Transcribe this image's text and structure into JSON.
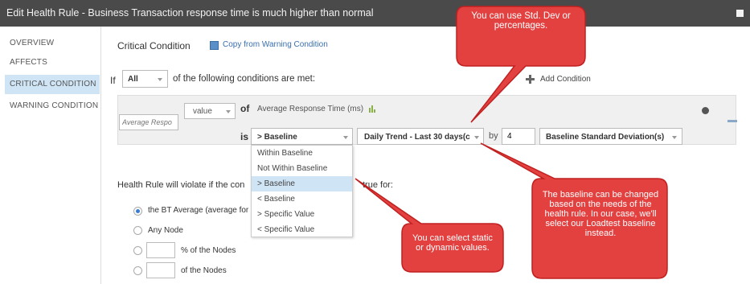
{
  "window": {
    "title": "Edit Health Rule - Business Transaction response time is much higher than normal"
  },
  "sidebar": {
    "items": [
      {
        "label": "OVERVIEW"
      },
      {
        "label": "AFFECTS"
      },
      {
        "label": "CRITICAL CONDITION"
      },
      {
        "label": "WARNING CONDITION"
      }
    ]
  },
  "header": {
    "title": "Critical Condition",
    "copy_link": "Copy from Warning Condition"
  },
  "if_row": {
    "if_label": "If",
    "match_value": "All",
    "suffix": "of the following conditions are met:",
    "add_condition": "Add Condition"
  },
  "condition": {
    "name_placeholder": "Average Respo",
    "value_select": "value",
    "of_label": "of",
    "metric": "Average Response Time (ms)",
    "is_label": "is",
    "operator": "> Baseline",
    "baseline": "Daily Trend - Last 30 days(c",
    "by_label": "by",
    "by_value": "4",
    "unit": "Baseline Standard Deviation(s)"
  },
  "operator_options": [
    "Within Baseline",
    "Not Within Baseline",
    "> Baseline",
    "< Baseline",
    "> Specific Value",
    "< Specific Value"
  ],
  "violate": {
    "text_left": "Health Rule will violate if the con",
    "text_right": "true for:",
    "options": [
      {
        "label": "the BT Average (average for a"
      },
      {
        "label": "Any Node"
      },
      {
        "label": "% of the Nodes"
      },
      {
        "label": "of the Nodes"
      }
    ]
  },
  "callouts": {
    "stddev": "You can use Std. Dev or percentages.",
    "baseline": "The baseline can be changed based on the needs of the health rule.  In our case, we'll select our Loadtest baseline instead.",
    "static": "You can select static or dynamic values."
  },
  "colors": {
    "callout_fill": "#e34040",
    "callout_border": "#c02020",
    "title_bar": "#4a4a4a",
    "accent": "#3a7bd5"
  }
}
